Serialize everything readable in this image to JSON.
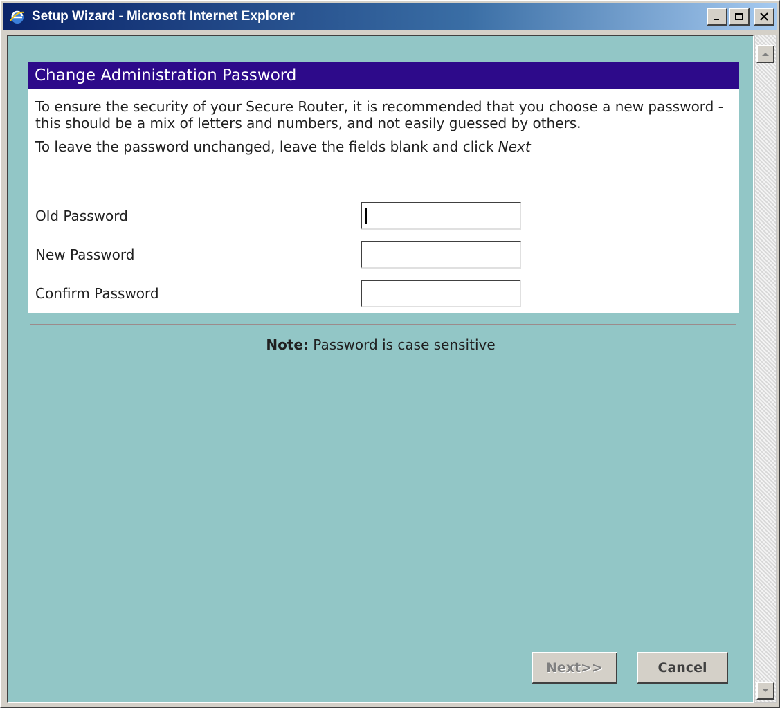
{
  "window": {
    "title": "Setup Wizard - Microsoft Internet Explorer",
    "browser_icon": "ie-icon",
    "controls": [
      "minimize-icon",
      "maximize-icon",
      "close-icon"
    ]
  },
  "panel": {
    "header": "Change Administration Password",
    "intro": "To ensure the security of your Secure Router, it is recommended that you choose a new password - this should be a mix of letters and numbers, and not easily guessed by others.",
    "instruction_prefix": "To leave the password unchanged, leave the fields blank and click ",
    "instruction_emphasis": "Next"
  },
  "fields": [
    {
      "label": "Old Password",
      "value": ""
    },
    {
      "label": "New Password",
      "value": ""
    },
    {
      "label": "Confirm Password",
      "value": ""
    }
  ],
  "note": {
    "label": "Note:",
    "text": " Password is case sensitive"
  },
  "buttons": {
    "next": "Next>>",
    "cancel": "Cancel"
  },
  "colors": {
    "page_background": "#92c6c6",
    "header_background": "#2d0a8a",
    "divider": "#9c8b8b"
  }
}
